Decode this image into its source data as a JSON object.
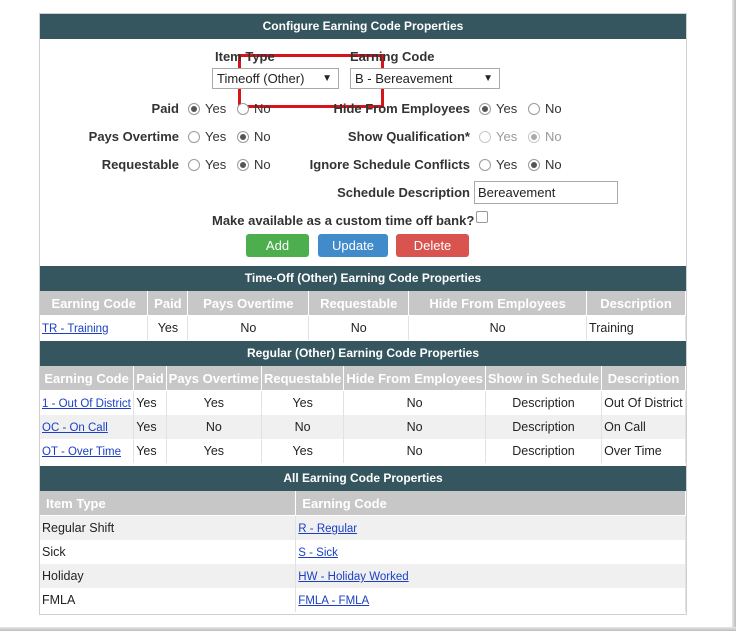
{
  "config": {
    "header": "Configure Earning Code Properties",
    "item_type_label": "Item Type",
    "item_type_value": "Timeoff (Other)",
    "earning_code_label": "Earning Code",
    "earning_code_value": "B - Bereavement",
    "yes": "Yes",
    "no": "No",
    "paid_label": "Paid",
    "pays_overtime_label": "Pays Overtime",
    "requestable_label": "Requestable",
    "hide_label": "Hide From Employees",
    "show_qual_label": "Show Qualification*",
    "ignore_label": "Ignore Schedule Conflicts",
    "sched_desc_label": "Schedule Description",
    "sched_desc_value": "Bereavement",
    "custom_bank_label": "Make available as a custom time off bank?",
    "add_label": "Add",
    "update_label": "Update",
    "delete_label": "Delete",
    "colors": {
      "add": "#4cae4c",
      "update": "#428bca",
      "delete": "#d9534f",
      "header": "#35565f"
    }
  },
  "timeoff": {
    "header": "Time-Off (Other) Earning Code Properties",
    "columns": [
      "Earning Code",
      "Paid",
      "Pays Overtime",
      "Requestable",
      "Hide From Employees",
      "Description"
    ],
    "rows": [
      {
        "code": "TR - Training",
        "paid": "Yes",
        "ot": "No",
        "req": "No",
        "hide": "No",
        "desc": "Training"
      }
    ]
  },
  "regular": {
    "header": "Regular (Other) Earning Code Properties",
    "columns": [
      "Earning Code",
      "Paid",
      "Pays Overtime",
      "Requestable",
      "Hide From Employees",
      "Show in Schedule",
      "Description"
    ],
    "rows": [
      {
        "code": "1 - Out Of District",
        "paid": "Yes",
        "ot": "Yes",
        "req": "Yes",
        "hide": "No",
        "show": "Description",
        "desc": "Out Of District"
      },
      {
        "code": "OC - On Call",
        "paid": "Yes",
        "ot": "No",
        "req": "No",
        "hide": "No",
        "show": "Description",
        "desc": "On Call"
      },
      {
        "code": "OT - Over Time",
        "paid": "Yes",
        "ot": "Yes",
        "req": "Yes",
        "hide": "No",
        "show": "Description",
        "desc": "Over Time"
      }
    ]
  },
  "all": {
    "header": "All Earning Code Properties",
    "columns": [
      "Item Type",
      "Earning Code"
    ],
    "rows": [
      {
        "type": "Regular Shift",
        "code": "R - Regular"
      },
      {
        "type": "Sick",
        "code": "S - Sick"
      },
      {
        "type": "Holiday",
        "code": "HW - Holiday Worked"
      },
      {
        "type": "FMLA",
        "code": "FMLA - FMLA"
      }
    ]
  }
}
